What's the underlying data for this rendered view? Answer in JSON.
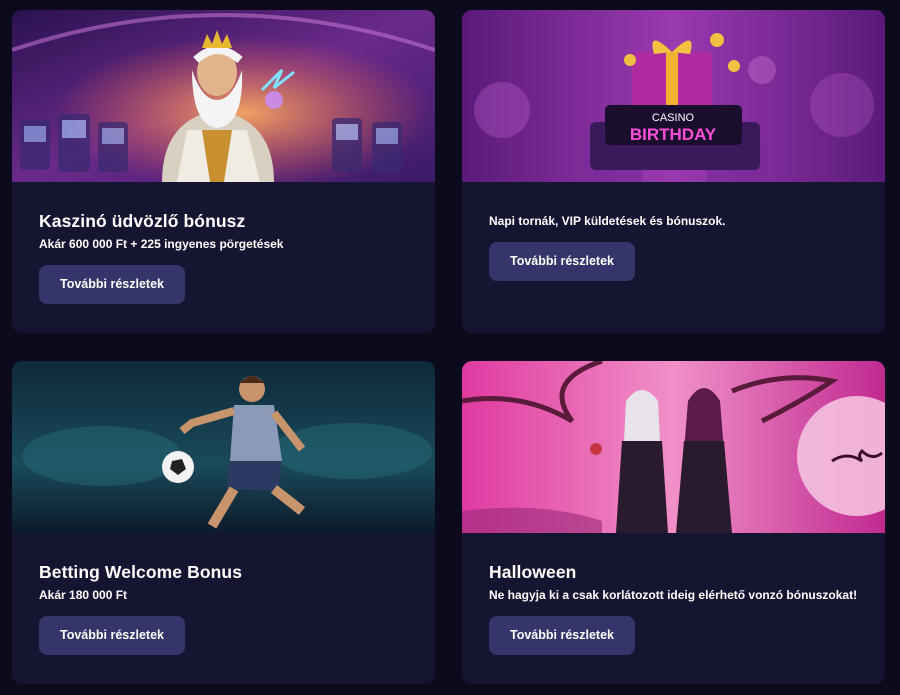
{
  "cards": [
    {
      "title": "Kaszinó üdvözlő bónusz",
      "subtitle": "Akár 600 000 Ft + 225 ingyenes pörgetések",
      "button_label": "További részletek",
      "image": "zeus-slot-machines"
    },
    {
      "title": "",
      "subtitle": "Napi tornák, VIP küldetések és bónuszok.",
      "button_label": "További részletek",
      "image": "birthday-gift-box",
      "image_text": {
        "brand": "CASINO",
        "headline": "BIRTHDAY"
      }
    },
    {
      "title": "Betting Welcome Bonus",
      "subtitle": "Akár 180 000 Ft",
      "button_label": "További részletek",
      "image": "football-player-stadium"
    },
    {
      "title": "Halloween",
      "subtitle": "Ne hagyja ki a csak korlátozott ideig elérhető vonzó bónuszokat!",
      "button_label": "További részletek",
      "image": "vampire-women-pink-moon"
    }
  ],
  "colors": {
    "page_background": "#0c0b1d",
    "card_background": "#151532",
    "button_background": "#35346b",
    "text": "#ffffff"
  }
}
